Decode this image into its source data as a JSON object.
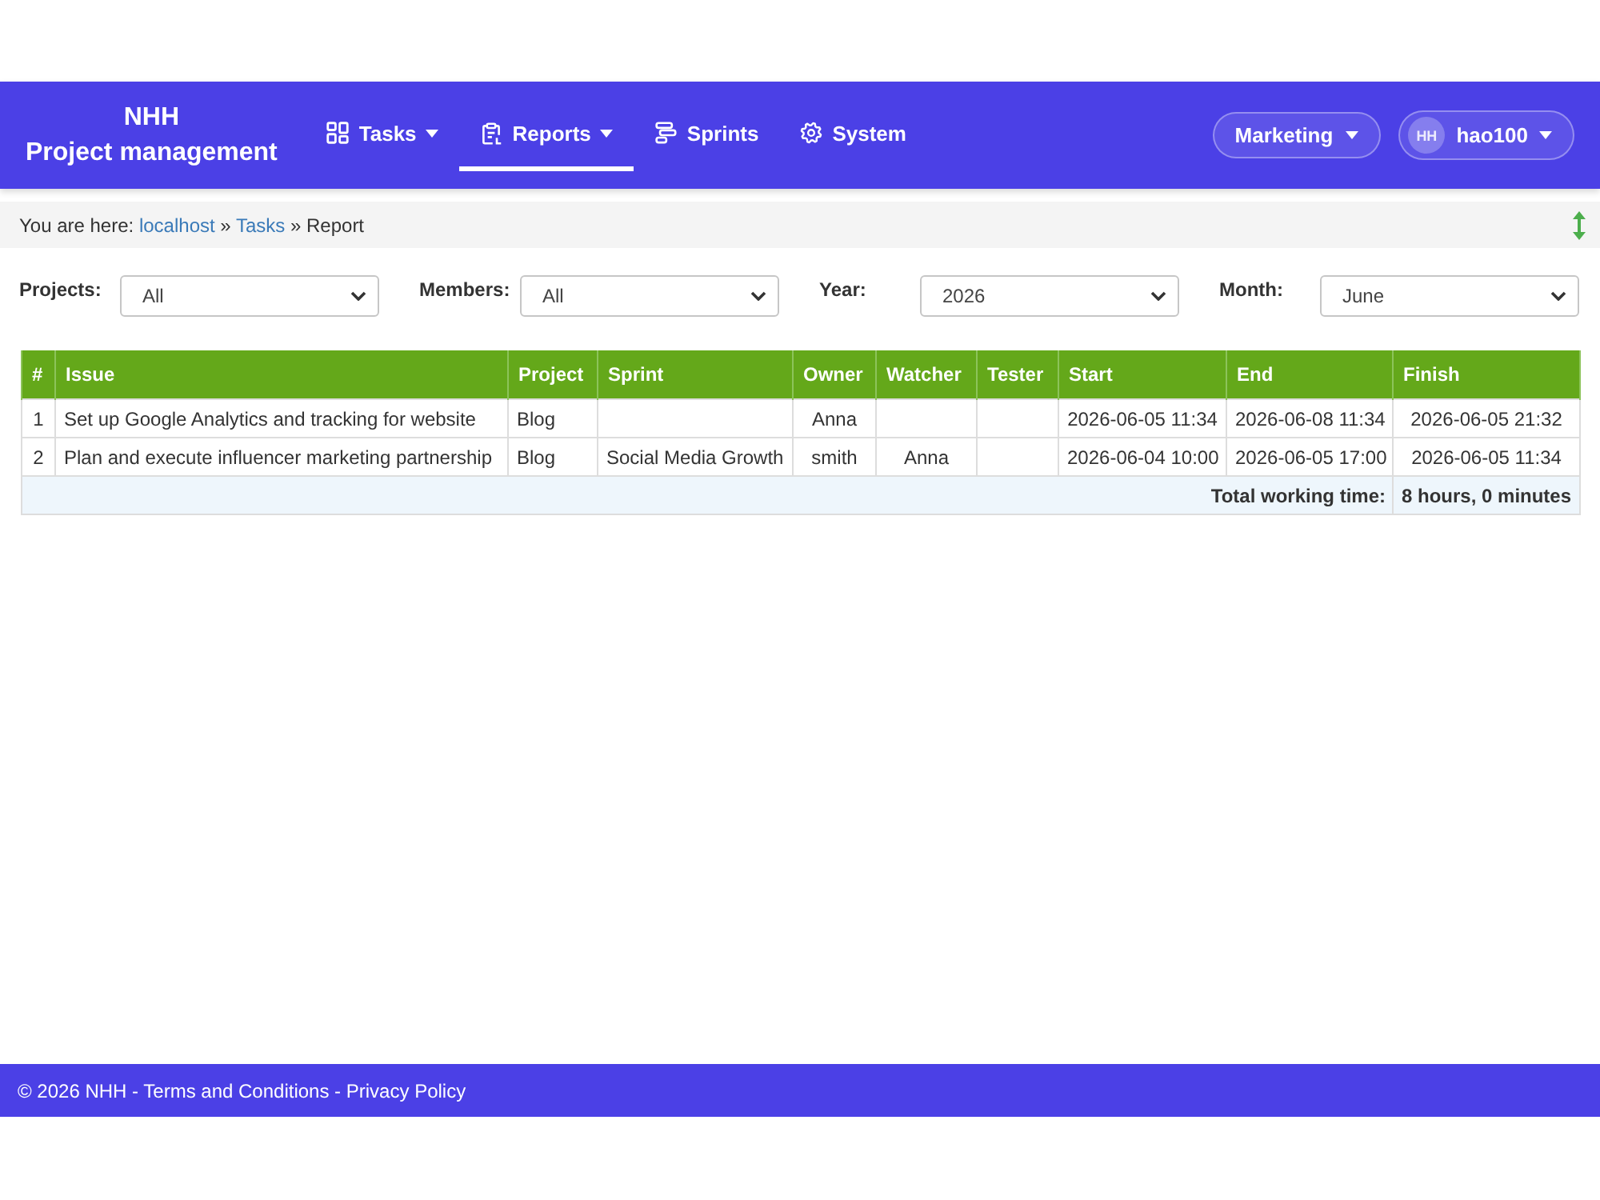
{
  "navbar": {
    "brand": [
      "NHH",
      "Project management"
    ],
    "nav_items": [
      {
        "label": "Tasks",
        "dropdown": true,
        "selected": false
      },
      {
        "label": "Reports",
        "dropdown": true,
        "selected": true
      },
      {
        "label": "Sprints",
        "dropdown": false,
        "selected": false
      },
      {
        "label": "System",
        "dropdown": false,
        "selected": false
      }
    ],
    "workspace_menu": {
      "label": "Marketing"
    },
    "user_menu": {
      "initials": "HH",
      "name": "hao100"
    }
  },
  "breadcrumb": {
    "label": "You are here:",
    "items": [
      {
        "kind": "link",
        "text": "localhost"
      },
      {
        "kind": "link",
        "separator": "»",
        "text": "Tasks"
      },
      {
        "kind": "current",
        "separator": "»",
        "text": "Report"
      }
    ]
  },
  "filters": [
    {
      "label": "Projects:",
      "value": "All"
    },
    {
      "label": "Members:",
      "value": "All"
    },
    {
      "label": "Year:",
      "value": "2026"
    },
    {
      "label": "Month:",
      "value": "June"
    }
  ],
  "table": {
    "columns": [
      "#",
      "Issue",
      "Project",
      "Sprint",
      "Owner",
      "Watcher",
      "Tester",
      "Start",
      "End",
      "Finish"
    ],
    "rows": [
      {
        "number": "1",
        "issue": "Set up Google Analytics and tracking for website",
        "project": "Blog",
        "owner": "Anna",
        "start": "2026-06-05 11:34",
        "end": "2026-06-08 11:34",
        "finish": "2026-06-05 21:32"
      },
      {
        "number": "2",
        "issue": "Plan and execute influencer marketing partnership",
        "project": "Blog",
        "sprint": "Social Media Growth",
        "owner": "smith",
        "watcher": "Anna",
        "start": "2026-06-04 10:00",
        "end": "2026-06-05 17:00",
        "finish": "2026-06-05 11:34"
      }
    ],
    "total": {
      "label": "Total working time:",
      "value": "8 hours, 0 minutes"
    }
  },
  "footer": {
    "text": "© 2026 NHH",
    "links": [
      {
        "separator": "-",
        "text": "Terms and Conditions"
      },
      {
        "separator": "-",
        "text": "Privacy Policy"
      }
    ]
  }
}
